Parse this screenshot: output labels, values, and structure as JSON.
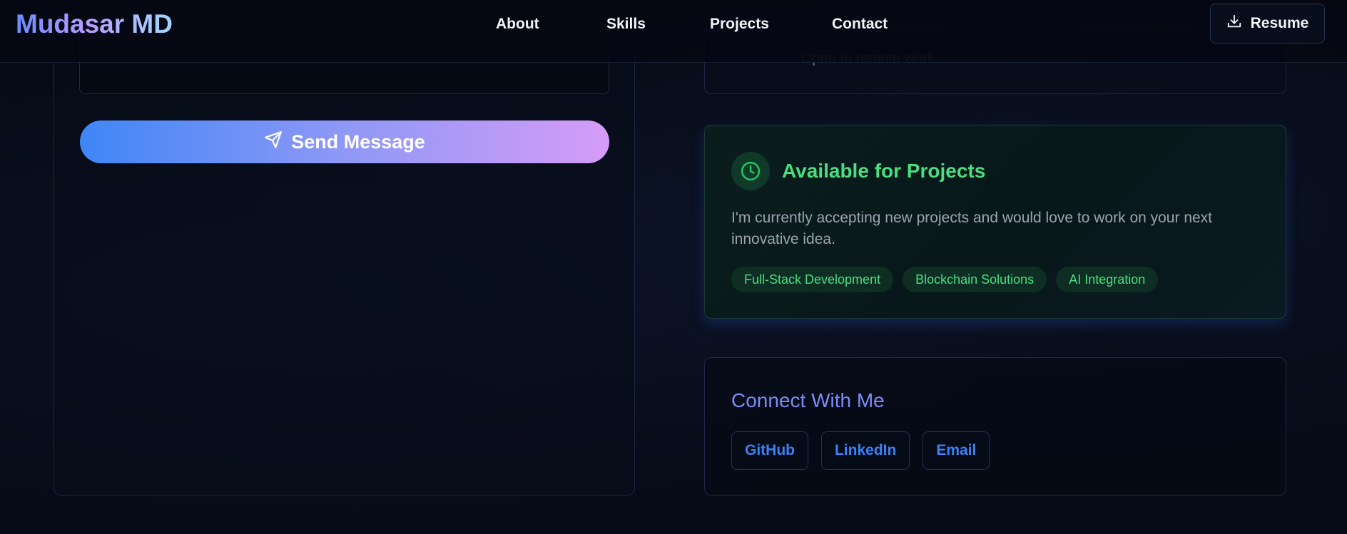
{
  "brand": {
    "logo_text": "Mudasar MD"
  },
  "nav": {
    "links": [
      "About",
      "Skills",
      "Projects",
      "Contact"
    ],
    "resume_label": "Resume"
  },
  "form": {
    "send_label": "Send Message"
  },
  "contact_info": {
    "partial_line": "Open to remote work"
  },
  "availability": {
    "title": "Available for Projects",
    "description": "I'm currently accepting new projects and would love to work on your next innovative idea.",
    "tags": [
      "Full-Stack Development",
      "Blockchain Solutions",
      "AI Integration"
    ]
  },
  "connect": {
    "title": "Connect With Me",
    "links": [
      "GitHub",
      "LinkedIn",
      "Email"
    ]
  },
  "icons": {
    "resume": "download-icon",
    "send": "send-icon",
    "availability": "clock-icon"
  },
  "colors": {
    "background": "#070b17",
    "accent_green": "#4ade80",
    "accent_blue": "#3b82f6",
    "connect_title": "#7c8cf6",
    "gradient_start": "#3f86f6",
    "gradient_end": "#d59cf7"
  }
}
